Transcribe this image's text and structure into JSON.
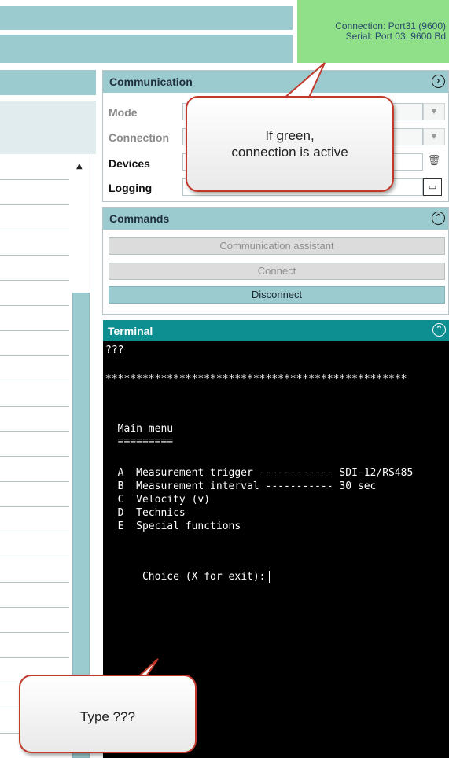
{
  "connection": {
    "line1": "Connection: Port31 (9600)",
    "line2": "Serial: Port 03, 9600 Bd",
    "status_color": "#8fe089"
  },
  "communication": {
    "title": "Communication",
    "mode_label": "Mode",
    "connection_label": "Connection",
    "devices_label": "Devices",
    "logging_label": "Logging",
    "delete_icon": "trash-icon",
    "folder_icon": "folder-icon"
  },
  "commands": {
    "title": "Commands",
    "assistant_label": "Communication assistant",
    "connect_label": "Connect",
    "disconnect_label": "Disconnect"
  },
  "terminal": {
    "title": "Terminal",
    "lines": [
      "???",
      "",
      "*************************************************",
      "",
      "",
      "",
      "  Main menu",
      "  =========",
      "",
      "  A  Measurement trigger ------------ SDI-12/RS485",
      "  B  Measurement interval ----------- 30 sec",
      "  C  Velocity (v)",
      "  D  Technics",
      "  E  Special functions",
      "",
      "Choice (X for exit):"
    ]
  },
  "callouts": {
    "green_line1": "If green,",
    "green_line2": "connection is active",
    "type_hint": "Type ???"
  },
  "colors": {
    "panel_header": "#9ccbcf",
    "terminal_header": "#0d8e90",
    "callout_border": "#c0392b"
  }
}
